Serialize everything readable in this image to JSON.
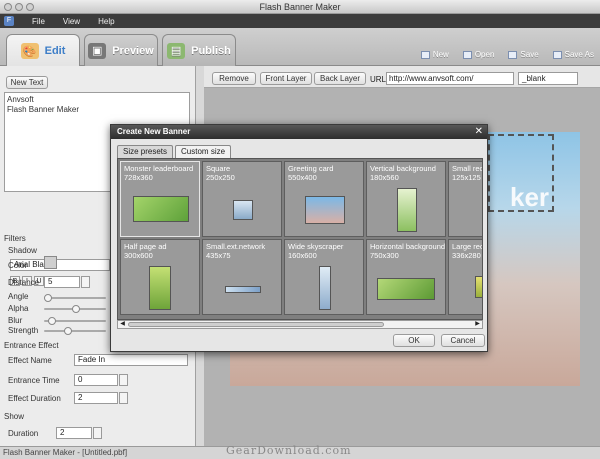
{
  "window": {
    "title": "Flash Banner Maker"
  },
  "menu": {
    "items": [
      "File",
      "View",
      "Help"
    ]
  },
  "tabs": [
    {
      "label": "Edit",
      "icon": "palette-icon"
    },
    {
      "label": "Preview",
      "icon": "film-icon"
    },
    {
      "label": "Publish",
      "icon": "box-icon"
    }
  ],
  "toolbar_right": [
    {
      "label": "New",
      "icon": "new-file-icon"
    },
    {
      "label": "Open",
      "icon": "open-folder-icon"
    },
    {
      "label": "Save",
      "icon": "save-icon"
    },
    {
      "label": "Save As",
      "icon": "save-as-icon"
    }
  ],
  "left": {
    "new_text": "New Text",
    "text_lines": [
      "Anvsoft",
      "Flash Banner Maker"
    ],
    "font": "Arial Black",
    "format_buttons": [
      "B",
      "I",
      "U",
      "L",
      "C",
      "R"
    ],
    "filters": {
      "heading": "Filters",
      "shadow": "Shadow",
      "color": "Color",
      "distance_label": "Distance",
      "distance": "5",
      "angle": "Angle",
      "alpha": "Alpha",
      "blur": "Blur",
      "strength": "Strength"
    },
    "entrance": {
      "heading": "Entrance Effect",
      "effect_name_label": "Effect Name",
      "effect_name": "Fade In",
      "entrance_time_label": "Entrance Time",
      "entrance_time": "0",
      "effect_duration_label": "Effect Duration",
      "effect_duration": "2"
    },
    "show": {
      "heading": "Show",
      "duration_label": "Duration",
      "duration": "2"
    }
  },
  "right_tools": {
    "remove": "Remove",
    "front_layer": "Front Layer",
    "back_layer": "Back Layer",
    "url_label": "URL",
    "url": "http://www.anvsoft.com/",
    "target": "_blank"
  },
  "stage": {
    "text": "ker"
  },
  "dialog": {
    "title": "Create New Banner",
    "tabs": [
      "Size presets",
      "Custom size"
    ],
    "presets": [
      {
        "name": "Monster leaderboard",
        "size": "728x360"
      },
      {
        "name": "Square",
        "size": "250x250"
      },
      {
        "name": "Greeting card",
        "size": "550x400"
      },
      {
        "name": "Vertical background",
        "size": "180x560"
      },
      {
        "name": "Small rec",
        "size": "125x125"
      },
      {
        "name": "Half page ad",
        "size": "300x600"
      },
      {
        "name": "Small.ext.network",
        "size": "435x75"
      },
      {
        "name": "Wide skyscraper",
        "size": "160x600"
      },
      {
        "name": "Horizontal background",
        "size": "750x300"
      },
      {
        "name": "Large rec",
        "size": "336x280"
      }
    ],
    "ok": "OK",
    "cancel": "Cancel"
  },
  "status": {
    "text": "Flash Banner Maker - [Untitled.pbf]"
  },
  "watermark": "GearDownload.com"
}
